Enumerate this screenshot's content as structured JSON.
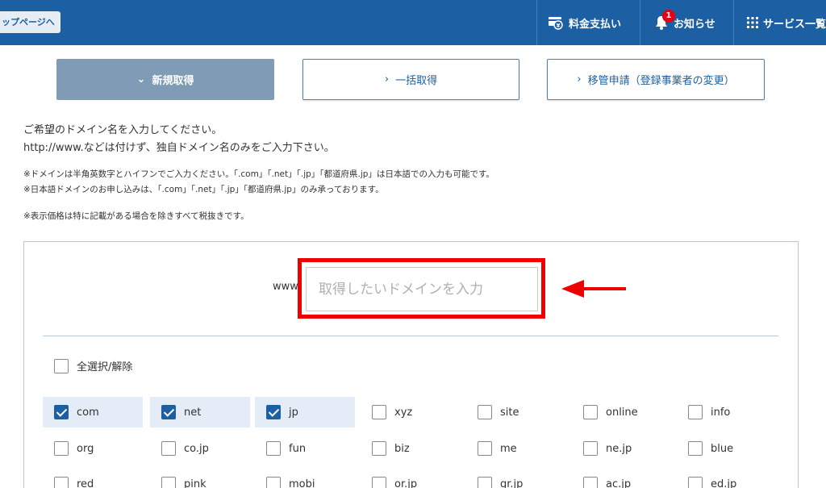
{
  "header": {
    "back_label": "ップページへ",
    "payment": "料金支払い",
    "news": "お知らせ",
    "news_badge": "1",
    "services": "サービス一覧"
  },
  "tabs": [
    {
      "label": "新規取得",
      "active": true
    },
    {
      "label": "一括取得",
      "active": false
    },
    {
      "label": "移管申請（登録事業者の変更）",
      "active": false
    }
  ],
  "intro": [
    "ご希望のドメイン名を入力してください。",
    "http://www.などは付けず、独自ドメイン名のみをご入力下さい。"
  ],
  "notes": [
    "※ドメインは半角英数字とハイフンでご入力ください。「.com」「.net」「.jp」「都道府県.jp」は日本語での入力も可能です。",
    "※日本語ドメインのお申し込みは、「.com」「.net」「.jp」「都道府県.jp」のみ承っております。",
    "※表示価格は特に記載がある場合を除きすべて税抜きです。"
  ],
  "search": {
    "prefix": "www.",
    "suffix": ".",
    "placeholder": "取得したいドメインを入力",
    "value": ""
  },
  "select_all_label": "全選択/解除",
  "tlds": [
    [
      {
        "name": "com",
        "checked": true
      },
      {
        "name": "net",
        "checked": true
      },
      {
        "name": "jp",
        "checked": true
      },
      {
        "name": "xyz",
        "checked": false
      },
      {
        "name": "site",
        "checked": false
      },
      {
        "name": "online",
        "checked": false
      },
      {
        "name": "info",
        "checked": false
      }
    ],
    [
      {
        "name": "org",
        "checked": false
      },
      {
        "name": "co.jp",
        "checked": false
      },
      {
        "name": "fun",
        "checked": false
      },
      {
        "name": "biz",
        "checked": false
      },
      {
        "name": "me",
        "checked": false
      },
      {
        "name": "ne.jp",
        "checked": false
      },
      {
        "name": "blue",
        "checked": false
      }
    ],
    [
      {
        "name": "red",
        "checked": false
      },
      {
        "name": "pink",
        "checked": false
      },
      {
        "name": "mobi",
        "checked": false
      },
      {
        "name": "or.jp",
        "checked": false
      },
      {
        "name": "gr.jp",
        "checked": false
      },
      {
        "name": "ac.jp",
        "checked": false
      },
      {
        "name": "ed.jp",
        "checked": false
      }
    ]
  ],
  "colors": {
    "header_bg": "#1d5fa3",
    "tab_active": "#7f9bb6",
    "highlight": "#ee0000",
    "checked": "#1d5fa3"
  }
}
